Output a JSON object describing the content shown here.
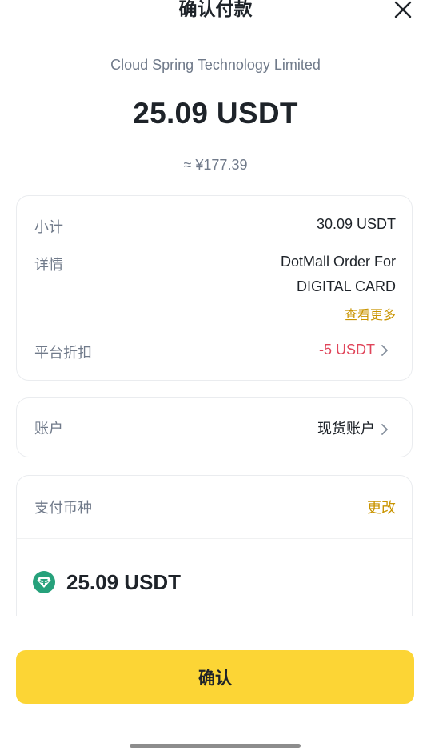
{
  "header": {
    "title": "确认付款",
    "close_icon": "close-icon"
  },
  "payment": {
    "merchant": "Cloud Spring Technology Limited",
    "amount": "25.09 USDT",
    "approx_cny": "≈ ¥177.39"
  },
  "details": {
    "subtotal_label": "小计",
    "subtotal_value": "30.09 USDT",
    "detail_label": "详情",
    "detail_line1": "DotMall Order For",
    "detail_line2": "DIGITAL CARD",
    "view_more": "查看更多",
    "discount_label": "平台折扣",
    "discount_value": "-5 USDT"
  },
  "account": {
    "label": "账户",
    "value": "现货账户"
  },
  "currency": {
    "label": "支付币种",
    "change": "更改",
    "coin_icon": "tether-icon",
    "amount": "25.09 USDT"
  },
  "actions": {
    "confirm_label": "确认"
  },
  "colors": {
    "accent_yellow": "#FCD535",
    "link_gold": "#C99400",
    "discount_red": "#E0455A",
    "tether_green": "#26A17B",
    "secondary_text": "#707A8A"
  }
}
